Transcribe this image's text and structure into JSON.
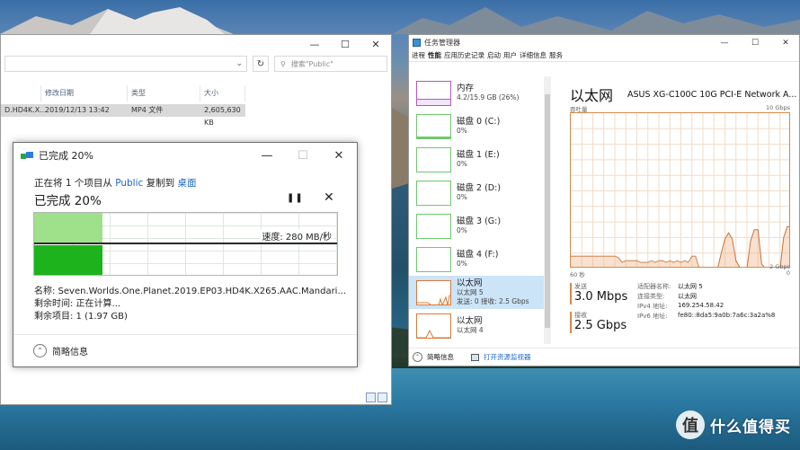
{
  "explorer": {
    "search_placeholder": "搜索\"Public\"",
    "columns": [
      "修改日期",
      "类型",
      "大小"
    ],
    "selected_file": {
      "name": "D.HD4K.X...",
      "modified": "2019/12/13 13:42",
      "type": "MP4 文件",
      "size": "2,605,630 KB"
    }
  },
  "copy_dialog": {
    "title": "已完成 20%",
    "line1_prefix": "正在将 1 个项目从 ",
    "source": "Public",
    "line1_mid": " 复制到 ",
    "destination": "桌面",
    "percent_heading": "已完成 20%",
    "progress_fraction": 0.2,
    "speed": "速度: 280 MB/秒",
    "name_line": "名称:  Seven.Worlds.One.Planet.2019.EP03.HD4K.X265.AAC.Mandari...",
    "time_remaining": "剩余时间:  正在计算...",
    "items_remaining": "剩余项目:  1 (1.97 GB)",
    "details_toggle": "简略信息"
  },
  "taskmgr": {
    "title": "任务管理器",
    "menu": [
      "进程",
      "性能",
      "应用历史记录",
      "启动",
      "用户",
      "详细信息",
      "服务"
    ],
    "active_menu": "性能",
    "sidebar": [
      {
        "main": "内存",
        "sub": "4.2/15.9 GB (26%)",
        "color": "purple"
      },
      {
        "main": "磁盘 0 (C:)",
        "sub": "0%",
        "color": "green"
      },
      {
        "main": "磁盘 1 (E:)",
        "sub": "0%",
        "color": "green"
      },
      {
        "main": "磁盘 2 (D:)",
        "sub": "0%",
        "color": "green"
      },
      {
        "main": "磁盘 3 (G:)",
        "sub": "0%",
        "color": "green"
      },
      {
        "main": "磁盘 4 (F:)",
        "sub": "0%",
        "color": "green"
      },
      {
        "main": "以太网",
        "sub": "以太网 5",
        "sub2": "发送: 0 接收: 2.5 Gbps",
        "color": "orange"
      },
      {
        "main": "以太网",
        "sub": "以太网 4",
        "color": "orange"
      }
    ],
    "header_title": "以太网",
    "adapter": "ASUS XG-C100C 10G PCI-E Network A...",
    "throughput_label": "吞吐量",
    "max_label": "10 Gbps",
    "mid_label": "2 Gbps",
    "time_label": "60 秒",
    "zero_label": "0",
    "send_label": "发送",
    "send_value": "3.0 Mbps",
    "recv_label": "接收",
    "recv_value": "2.5 Gbps",
    "info": [
      {
        "k": "适配器名称:",
        "v": "以太网 5"
      },
      {
        "k": "连接类型:",
        "v": "以太网"
      },
      {
        "k": "IPv4 地址:",
        "v": "169.254.58.42"
      },
      {
        "k": "IPv6 地址:",
        "v": "fe80::8da5:9a0b:7a6c:3a2a%8"
      }
    ],
    "footer_summary": "简略信息",
    "footer_link": "打开资源监视器",
    "chart": {
      "ymax_gbps": 10,
      "receive_series_gbps": [
        0.8,
        0.8,
        0.8,
        0.8,
        0.8,
        0.8,
        0.8,
        0.8,
        0.8,
        0.8,
        0.8,
        0.8,
        0.8,
        0.7,
        0.4,
        0.5,
        0.5,
        0.5,
        0.5,
        0.4,
        0.4,
        0.4,
        0.5,
        0.4,
        0.5,
        0.5,
        0.4,
        0.5,
        0.4,
        0.5,
        0.4,
        0.5,
        0.4,
        0.8,
        0.8,
        0.0,
        0.0,
        0.0,
        0.0,
        0.0,
        0.0,
        1.0,
        1.9,
        2.3,
        1.9,
        0.5,
        0.1,
        0.0,
        0.0,
        1.8,
        2.5,
        2.5,
        0.3,
        0.0,
        0.0,
        0.0,
        0.0,
        0.0,
        2.0,
        2.7,
        2.7
      ],
      "send_series_gbps": [
        0.8,
        0.8,
        0.8,
        0.8,
        0.8,
        0.8,
        0.8,
        0.8,
        0.8,
        0.8,
        0.8,
        0.8,
        0.8,
        0.7,
        0.4,
        0.5,
        0.5,
        0.5,
        0.5,
        0.4,
        0.4,
        0.4,
        0.5,
        0.4,
        0.5,
        0.5,
        0.4,
        0.5,
        0.4,
        0.5,
        0.4,
        0.5,
        0.4,
        0.8,
        0.8,
        0.0,
        0.0,
        0.0,
        0.0,
        0.0,
        0.0,
        0.0,
        0.0,
        0.0,
        0.0,
        0.0,
        0.0,
        0.0,
        0.0,
        0.0,
        0.0,
        0.0,
        0.0,
        0.0,
        0.0,
        0.0,
        0.0,
        0.0,
        0.0,
        0.0,
        0.0
      ]
    }
  },
  "watermark": {
    "logo": "值",
    "text": "什么值得买"
  }
}
